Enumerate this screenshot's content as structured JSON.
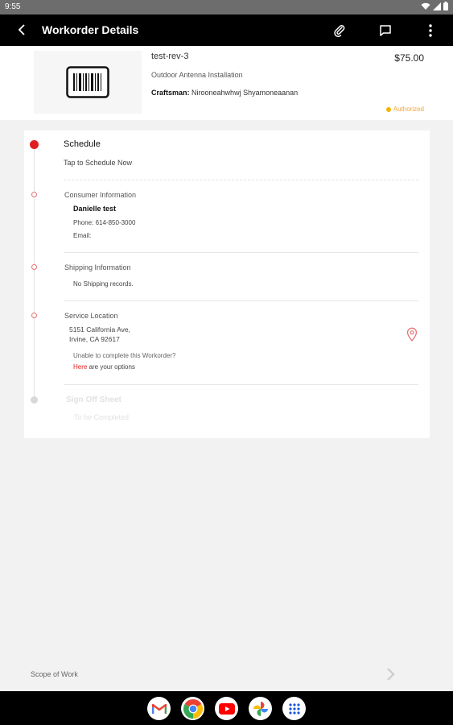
{
  "status_bar": {
    "time": "9:55",
    "icons": [
      "wifi-icon",
      "signal-icon",
      "battery-icon"
    ]
  },
  "app_bar": {
    "title": "Workorder Details",
    "icons": [
      "back-arrow-icon",
      "paperclip-icon",
      "comment-icon",
      "more-vert-icon"
    ]
  },
  "workorder": {
    "name": "test-rev-3",
    "service": "Outdoor Antenna Installation",
    "craftsman_label": "Craftsman:",
    "craftsman_name": "Nirooneahwhwj Shyamoneaanan",
    "price": "$75.00",
    "status": "Authorized",
    "thumbnail_icon": "barcode-icon"
  },
  "timeline": {
    "schedule": {
      "title": "Schedule",
      "subtitle": "Tap to Schedule Now"
    },
    "consumer": {
      "title": "Consumer Information",
      "name": "Danielle test",
      "phone": "Phone: 614-850-3000",
      "email": "Email:"
    },
    "shipping": {
      "title": "Shipping Information",
      "note": "No Shipping records."
    },
    "service_location": {
      "title": "Service Location",
      "address_line1": "5151 California Ave,",
      "address_line2": "Irvine, CA 92617",
      "help_text": "Unable to complete this Workorder?",
      "link_text": "Here",
      "options_text": " are your options"
    },
    "signoff": {
      "title": "Sign Off Sheet",
      "subtitle": "To be Completed"
    }
  },
  "footer": {
    "scope_label": "Scope of Work"
  },
  "nav_apps": [
    "gmail-icon",
    "chrome-icon",
    "youtube-icon",
    "photos-icon",
    "app-drawer-icon"
  ],
  "colors": {
    "accent": "#e02020",
    "status": "#f5b400",
    "appbar": "#000000"
  }
}
